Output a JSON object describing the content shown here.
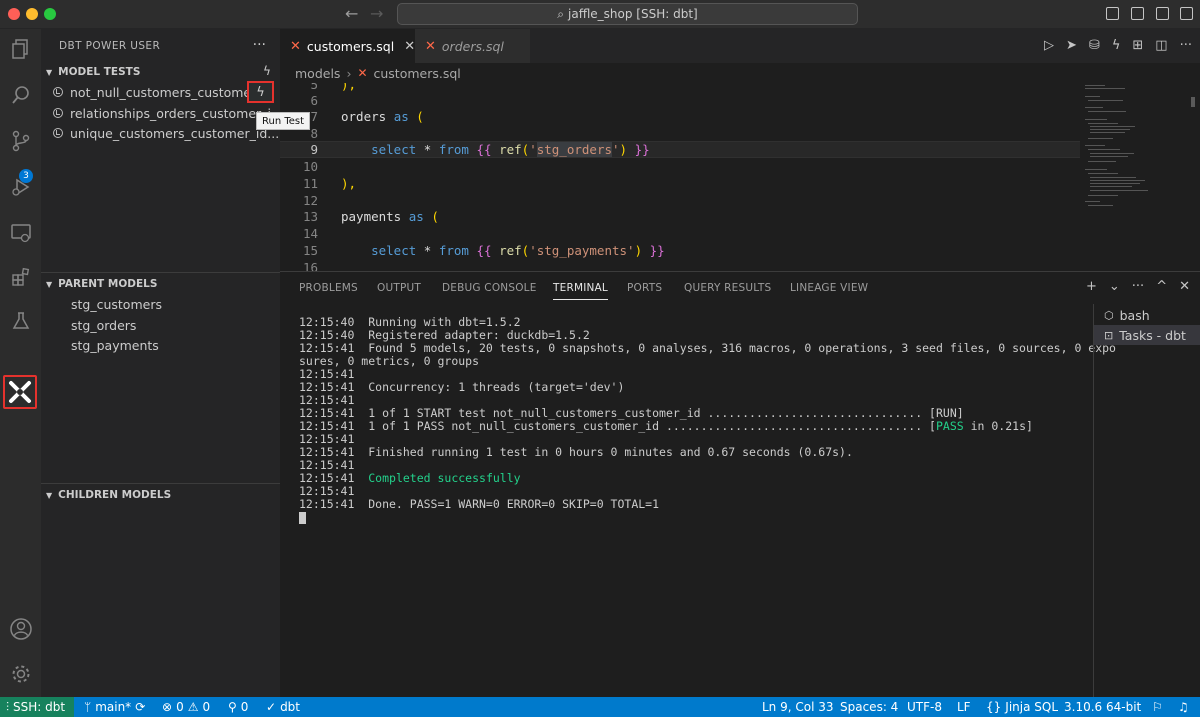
{
  "window": {
    "title": "jaffle_shop [SSH: dbt]"
  },
  "activity_bar": {
    "source_control_badge": "3"
  },
  "sidebar": {
    "title": "DBT POWER USER",
    "more": "···",
    "model_tests": {
      "header": "MODEL TESTS",
      "items": [
        "not_null_customers_custome...",
        "relationships_orders_customer_i",
        "unique_customers_customer_id...."
      ],
      "run_test_tooltip": "Run Test"
    },
    "parent_models": {
      "header": "PARENT MODELS",
      "items": [
        "stg_customers",
        "stg_orders",
        "stg_payments"
      ]
    },
    "children_models": {
      "header": "CHILDREN MODELS"
    }
  },
  "editor": {
    "tabs": [
      {
        "label": "customers.sql",
        "active": true
      },
      {
        "label": "orders.sql",
        "active": false
      }
    ],
    "breadcrumb": [
      "models",
      "customers.sql"
    ],
    "lines": [
      {
        "n": "5",
        "text": "),"
      },
      {
        "n": "6",
        "text": ""
      },
      {
        "n": "7",
        "text": "orders as ("
      },
      {
        "n": "8",
        "text": ""
      },
      {
        "n": "9",
        "text": "    select * from {{ ref('stg_orders') }}"
      },
      {
        "n": "10",
        "text": ""
      },
      {
        "n": "11",
        "text": "),"
      },
      {
        "n": "12",
        "text": ""
      },
      {
        "n": "13",
        "text": "payments as ("
      },
      {
        "n": "14",
        "text": ""
      },
      {
        "n": "15",
        "text": "    select * from {{ ref('stg_payments') }}"
      },
      {
        "n": "16",
        "text": ""
      }
    ]
  },
  "panel": {
    "tabs": [
      "PROBLEMS",
      "OUTPUT",
      "DEBUG CONSOLE",
      "TERMINAL",
      "PORTS",
      "QUERY RESULTS",
      "LINEAGE VIEW"
    ],
    "active_tab": "TERMINAL",
    "terminal_lines": [
      "12:15:40  Running with dbt=1.5.2",
      "12:15:40  Registered adapter: duckdb=1.5.2",
      "12:15:41  Found 5 models, 20 tests, 0 snapshots, 0 analyses, 316 macros, 0 operations, 3 seed files, 0 sources, 0 expo",
      "sures, 0 metrics, 0 groups",
      "12:15:41",
      "12:15:41  Concurrency: 1 threads (target='dev')",
      "12:15:41",
      "12:15:41  1 of 1 START test not_null_customers_customer_id ............................... [RUN]",
      "12:15:41  1 of 1 PASS not_null_customers_customer_id ..................................... [",
      "12:15:41",
      "12:15:41  Finished running 1 test in 0 hours 0 minutes and 0.67 seconds (0.67s).",
      "12:15:41",
      "12:15:41  ",
      "12:15:41",
      "12:15:41  Done. PASS=1 WARN=0 ERROR=0 SKIP=0 TOTAL=1"
    ],
    "pass_word": "PASS",
    "pass_suffix": " in 0.21s]",
    "completed": "Completed successfully",
    "terminals": [
      "bash",
      "Tasks - dbt"
    ]
  },
  "statusbar": {
    "remote": "SSH: dbt",
    "branch": "main*",
    "errors": "0",
    "warnings": "0",
    "ports": "0",
    "dbt": "dbt",
    "position": "Ln 9, Col 33",
    "spaces": "Spaces: 4",
    "encoding": "UTF-8",
    "eol": "LF",
    "language": "Jinja SQL",
    "python": "3.10.6 64-bit"
  }
}
